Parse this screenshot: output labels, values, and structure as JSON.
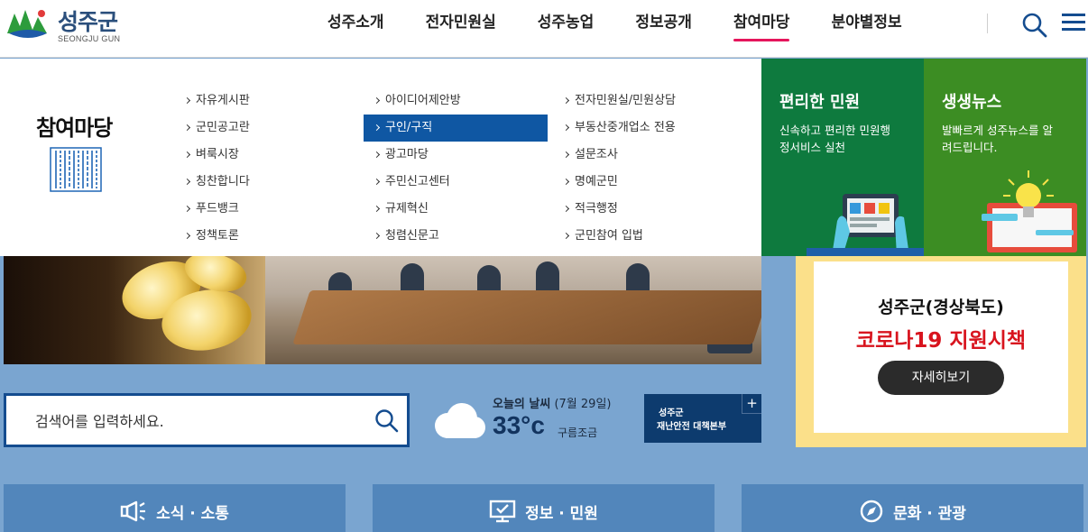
{
  "header": {
    "logo_title": "성주군",
    "logo_sub": "SEONGJU GUN",
    "nav": [
      {
        "label": "성주소개",
        "active": false
      },
      {
        "label": "전자민원실",
        "active": false
      },
      {
        "label": "성주농업",
        "active": false
      },
      {
        "label": "정보공개",
        "active": false
      },
      {
        "label": "참여마당",
        "active": true
      },
      {
        "label": "분야별정보",
        "active": false
      }
    ]
  },
  "mega_menu": {
    "title": "참여마당",
    "columns": [
      [
        "자유게시판",
        "군민공고란",
        "벼룩시장",
        "칭찬합니다",
        "푸드뱅크",
        "정책토론"
      ],
      [
        "아이디어제안방",
        "구인/구직",
        "광고마당",
        "주민신고센터",
        "규제혁신",
        "청렴신문고"
      ],
      [
        "전자민원실/민원상담",
        "부동산중개업소 전용",
        "설문조사",
        "명예군민",
        "적극행정",
        "군민참여 입법"
      ]
    ],
    "active_item": "구인/구직"
  },
  "promos": [
    {
      "title": "편리한 민원",
      "text": "신속하고 편리한 민원행정서비스 실천",
      "color": "#0e7a3e"
    },
    {
      "title": "생생뉴스",
      "text": "발빠르게 성주뉴스를 알려드립니다.",
      "color": "#3c8d23"
    }
  ],
  "search": {
    "placeholder": "검색어를 입력하세요."
  },
  "weather": {
    "title": "오늘의 날씨",
    "date": "(7월 29일)",
    "temp": "33°c",
    "desc": "구름조금"
  },
  "disaster": {
    "line1": "성주군",
    "line2": "재난안전 대책본부",
    "plus": "+"
  },
  "covid": {
    "line1": "성주군(경상북도)",
    "line2": "코로나19 지원시책",
    "button": "자세히보기"
  },
  "categories": [
    {
      "label": "소식 · 소통",
      "icon": "megaphone-icon"
    },
    {
      "label": "정보 · 민원",
      "icon": "monitor-check-icon"
    },
    {
      "label": "문화 · 관광",
      "icon": "compass-icon"
    }
  ],
  "colors": {
    "brand_navy": "#144c8f",
    "active_pink": "#e5165c",
    "menu_active": "#0f57a3",
    "covid_red": "#d8141e"
  }
}
